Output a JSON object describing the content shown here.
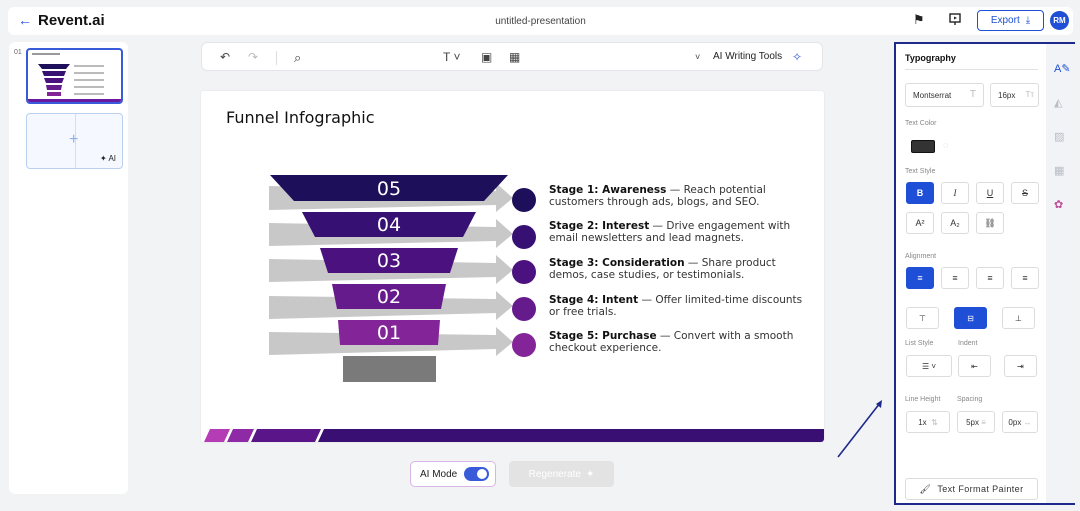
{
  "app": {
    "brand": "Revent.ai",
    "document_title": "untitled-presentation"
  },
  "header": {
    "export_label": "Export",
    "avatar_initials": "RM",
    "accent": "#1f4fd6"
  },
  "thumbnails": {
    "slide_number": "01",
    "ai_label": "AI"
  },
  "toolbar": {
    "ai_writing_tools": "AI Writing Tools"
  },
  "slide": {
    "title": "Funnel Infographic",
    "funnel_numbers": [
      "05",
      "04",
      "03",
      "02",
      "01"
    ],
    "stages": [
      {
        "name": "Stage 1: Awareness",
        "desc": " — Reach potential customers through ads, blogs, and SEO."
      },
      {
        "name": "Stage 2: Interest",
        "desc": " — Drive engagement with email newsletters and lead magnets."
      },
      {
        "name": "Stage 3: Consideration",
        "desc": " — Share product demos, case studies, or testimonials."
      },
      {
        "name": "Stage 4: Intent",
        "desc": " — Offer limited-time discounts or free trials."
      },
      {
        "name": "Stage 5: Purchase",
        "desc": " — Convert with a smooth checkout experience."
      }
    ],
    "colors": [
      "#1e0f5a",
      "#361173",
      "#4a117f",
      "#661b8c",
      "#832598",
      "#7a7a7a"
    ]
  },
  "bottom": {
    "ai_mode_label": "AI Mode",
    "regenerate_label": "Regenerate"
  },
  "panel": {
    "title": "Typography",
    "font_family": "Montserrat",
    "font_size": "16px",
    "text_color_label": "Text Color",
    "text_style_label": "Text Style",
    "alignment_label": "Alignment",
    "list_style_label": "List Style",
    "indent_label": "Indent",
    "line_height_label": "Line Height",
    "spacing_label": "Spacing",
    "line_height_value": "1x",
    "spacing_value": "5px",
    "letter_spacing_value": "0px",
    "painter_label": "Text Format Painter",
    "superscript": "A²",
    "subscript": "A₂"
  }
}
